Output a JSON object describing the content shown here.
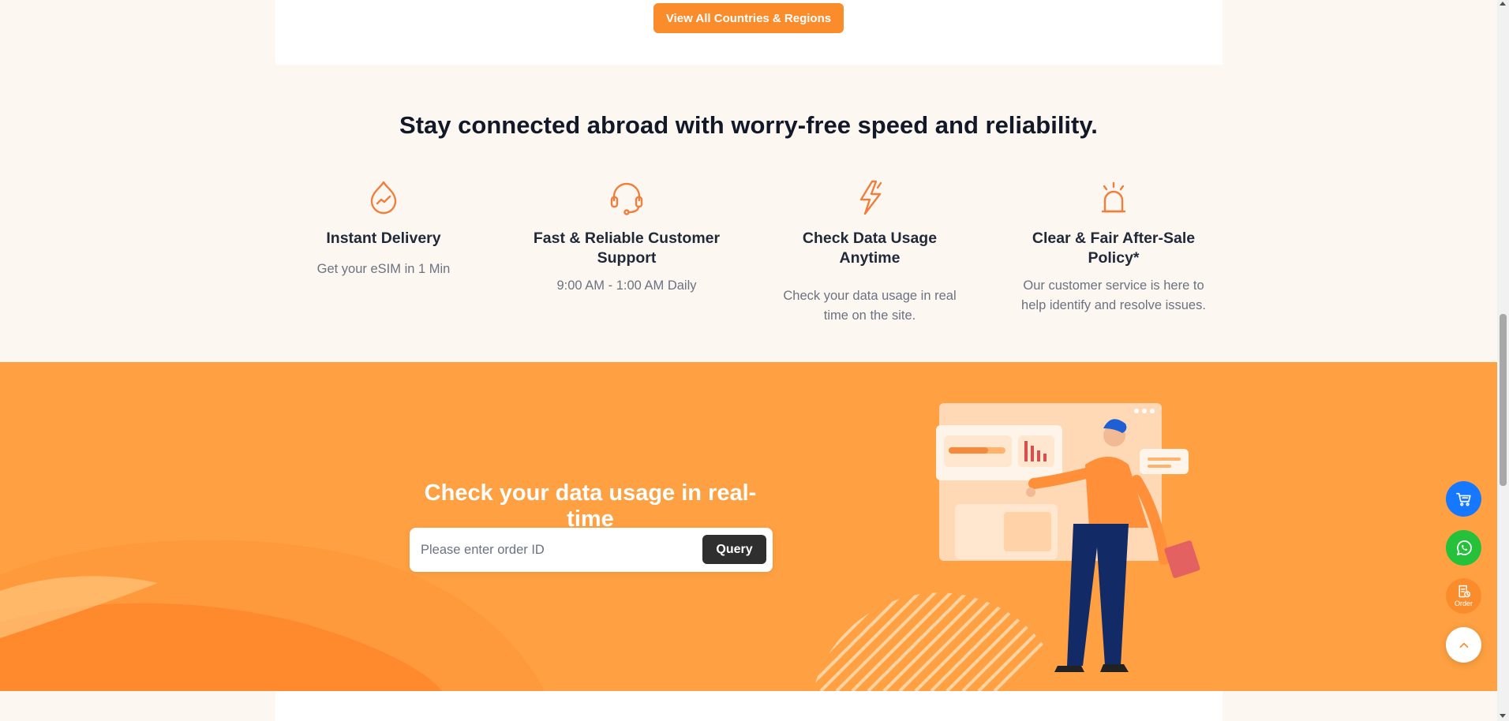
{
  "top": {
    "view_all_label": "View All Countries & Regions"
  },
  "features": {
    "title": "Stay connected abroad with worry-free speed and reliability.",
    "items": [
      {
        "icon": "drop-chart-icon",
        "title": "Instant Delivery",
        "desc": "Get your eSIM in 1 Min"
      },
      {
        "icon": "headset-icon",
        "title": "Fast & Reliable Customer Support",
        "desc": "9:00 AM - 1:00 AM Daily"
      },
      {
        "icon": "lightning-icon",
        "title": "Check Data Usage Anytime",
        "desc": "Check your data usage in real time on the site."
      },
      {
        "icon": "alarm-bell-icon",
        "title": "Clear & Fair After-Sale Policy*",
        "desc": "Our customer service is here to help identify and resolve issues."
      }
    ]
  },
  "usage": {
    "title": "Check your data usage in real-time",
    "input_placeholder": "Please enter order ID",
    "query_label": "Query"
  },
  "floating": {
    "cart_icon": "cart-icon",
    "whatsapp_icon": "whatsapp-icon",
    "order_icon": "order-icon",
    "order_label": "Order",
    "top_icon": "chevron-up-icon"
  },
  "colors": {
    "accent": "#fb8c2c",
    "band": "#ffa142",
    "cart": "#1677ff",
    "whatsapp": "#25c13b",
    "dark_button": "#2f2f2f"
  }
}
